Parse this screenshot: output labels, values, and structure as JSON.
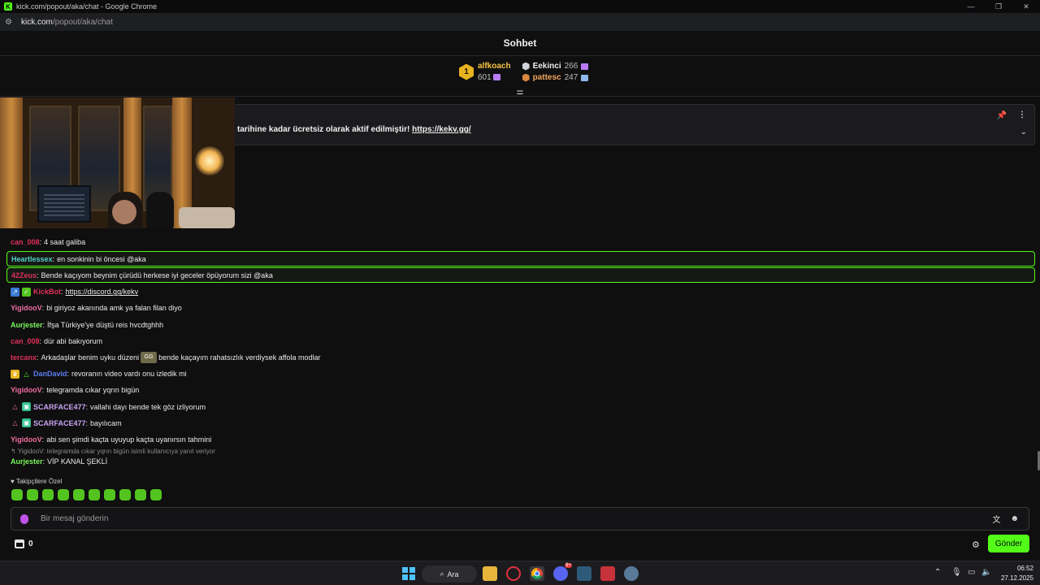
{
  "window": {
    "title": "kick.com/popout/aka/chat - Google Chrome",
    "url_host": "kick.com",
    "url_path": "/popout/aka/chat"
  },
  "chat": {
    "header_title": "Sohbet",
    "leaderboard": {
      "first": {
        "rank": "1",
        "name": "alfkoach",
        "count": "601"
      },
      "others": [
        {
          "name": "Eekinci",
          "count": "266"
        },
        {
          "name": "pattesc",
          "count": "247"
        }
      ]
    },
    "pinned": {
      "text": "tarihine kadar ücretsiz olarak aktif edilmiştir!",
      "link": "https://kekv.gg/"
    },
    "messages": [
      {
        "user": "can_008",
        "color": "#e0315a",
        "text": "4 saat galiba"
      },
      {
        "user": "Heartlessex",
        "color": "#53d4c8",
        "text": "en sonkinin bi öncesi @aka",
        "highlight": true
      },
      {
        "user": "42Zeus",
        "color": "#e0315a",
        "text": "Bende kaçıyom beynim çürüdü herkese iyi geceler öpüyorum sizi @aka",
        "highlight": true
      },
      {
        "user": "KickBot",
        "color": "#e0315a",
        "text": "https://discord.gg/kekv",
        "badges": [
          "bot",
          "verified"
        ],
        "link": true
      },
      {
        "user": "YigidooV",
        "color": "#f06da0",
        "text": "bi giriyoz akanında amk ya falan filan diyo"
      },
      {
        "user": "Aurjester",
        "color": "#7bf55a",
        "text": "İfşa Türkiye'ye düştü reis hvcdtghhh"
      },
      {
        "user": "can_008",
        "color": "#e0315a",
        "text": "dür abi bakıyorum"
      },
      {
        "user": "tercanx",
        "color": "#e0315a",
        "text": "Arkadaşlar benim uyku düzeni",
        "emote": "GG",
        "text_after": "bende kaçayım rahatsızlık verdiysek affola modlar"
      },
      {
        "user": "DanDavid",
        "color": "#5a7ff0",
        "text": "revoranın video vardı onu izledik mi",
        "badges": [
          "crown",
          "triangle"
        ]
      },
      {
        "user": "YigidooV",
        "color": "#f06da0",
        "text": "telegramda cıkar yqrın bigün"
      },
      {
        "user": "SCARFACE477",
        "color": "#c9a4f2",
        "text": "vallahi dayı bende tek göz izliyorum",
        "badges": [
          "triangle-pink",
          "gift-green"
        ]
      },
      {
        "user": "SCARFACE477",
        "color": "#c9a4f2",
        "text": "bayılıcam",
        "badges": [
          "triangle-pink",
          "gift-green"
        ]
      },
      {
        "user": "YigidooV",
        "color": "#f06da0",
        "text": "abi sen şimdi kaçta uyuyup kaçta uyanırsın tahmini"
      }
    ],
    "reply_context": "YigidooV: telegramda cıkar yqrın bigün isimli kullanıcıya yanıt veriyor",
    "last_message": {
      "user": "Aurjester",
      "color": "#7bf55a",
      "text": "VİP KANAL ŞEKLİ"
    },
    "followers_only_label": "Takipçilere Özel",
    "input_placeholder": "Bir mesaj gönderin",
    "points": "0",
    "send_label": "Gönder",
    "accent": "#53fc18"
  },
  "taskbar": {
    "search_label": "Ara",
    "time": "06:52",
    "date": "27.12.2025",
    "discord_badge": "9+"
  }
}
